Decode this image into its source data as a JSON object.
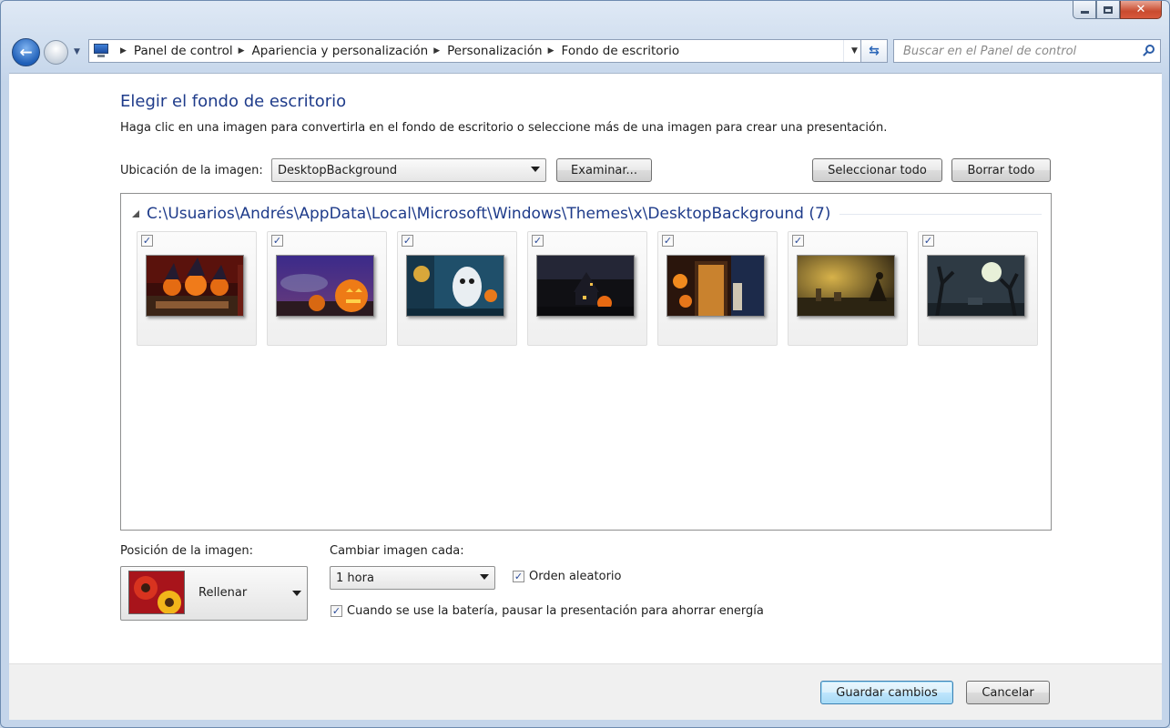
{
  "window": {
    "caption": {
      "close_glyph": "✕"
    }
  },
  "nav": {
    "back_glyph": "←",
    "breadcrumbs": [
      "Panel de control",
      "Apariencia y personalización",
      "Personalización",
      "Fondo de escritorio"
    ],
    "search_placeholder": "Buscar en el Panel de control"
  },
  "page": {
    "title": "Elegir el fondo de escritorio",
    "description": "Haga clic en una imagen para convertirla en el fondo de escritorio o seleccione más de una imagen para crear una presentación."
  },
  "location": {
    "label": "Ubicación de la imagen:",
    "selected": "DesktopBackground",
    "browse_label": "Examinar...",
    "select_all_label": "Seleccionar todo",
    "clear_all_label": "Borrar todo"
  },
  "gallery": {
    "group_title": "C:\\Usuarios\\Andrés\\AppData\\Local\\Microsoft\\Windows\\Themes\\x\\DesktopBackground (7)",
    "images": [
      {
        "checked": true,
        "icon": "halloween-pumpkins-witch-hats"
      },
      {
        "checked": true,
        "icon": "halloween-jack-o-lantern-purple-sky"
      },
      {
        "checked": true,
        "icon": "halloween-ghost-blue"
      },
      {
        "checked": true,
        "icon": "halloween-haunted-house-night"
      },
      {
        "checked": true,
        "icon": "halloween-door-pumpkin-lanterns"
      },
      {
        "checked": true,
        "icon": "halloween-graveyard-sunset"
      },
      {
        "checked": true,
        "icon": "halloween-moon-dead-trees"
      }
    ]
  },
  "options": {
    "position_label": "Posición de la imagen:",
    "position_value": "Rellenar",
    "interval_label": "Cambiar imagen cada:",
    "interval_value": "1 hora",
    "shuffle_label": "Orden aleatorio",
    "battery_label": "Cuando se use la batería, pausar la presentación para ahorrar energía",
    "check_glyph": "✓"
  },
  "footer": {
    "save_label": "Guardar cambios",
    "cancel_label": "Cancelar"
  }
}
